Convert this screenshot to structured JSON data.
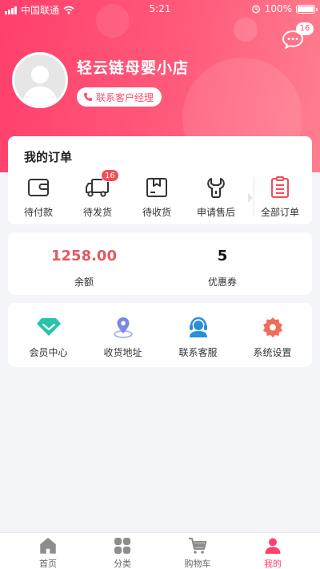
{
  "status_bar": {
    "carrier": "中国联通",
    "time": "5:21",
    "battery": "100%"
  },
  "header": {
    "message_badge": "16",
    "shop_name": "轻云链母婴小店",
    "contact_button": "联系客户经理"
  },
  "orders": {
    "title": "我的订单",
    "items": [
      {
        "label": "待付款",
        "icon": "wallet-icon"
      },
      {
        "label": "待发货",
        "icon": "truck-icon",
        "badge": "16"
      },
      {
        "label": "待收货",
        "icon": "box-icon"
      },
      {
        "label": "申请售后",
        "icon": "wrench-icon"
      },
      {
        "label": "全部订单",
        "icon": "list-icon"
      }
    ]
  },
  "stats": {
    "balance_value": "1258.00",
    "balance_label": "余额",
    "coupon_value": "5",
    "coupon_label": "优惠券"
  },
  "services": [
    {
      "label": "会员中心",
      "icon": "diamond-icon"
    },
    {
      "label": "收货地址",
      "icon": "location-pin-icon"
    },
    {
      "label": "联系客服",
      "icon": "headset-icon"
    },
    {
      "label": "系统设置",
      "icon": "gear-icon"
    }
  ],
  "tabbar": [
    {
      "label": "首页",
      "icon": "home-icon"
    },
    {
      "label": "分类",
      "icon": "grid-icon"
    },
    {
      "label": "购物车",
      "icon": "cart-icon"
    },
    {
      "label": "我的",
      "icon": "person-icon",
      "active": true
    }
  ],
  "colors": {
    "brand": "#ff4b6e",
    "balance": "#e05a63",
    "badge": "#f14d5b",
    "diamond": "#27c4a8",
    "location": "#7a86e8",
    "headset": "#2a8fd8",
    "gear": "#f06c5a"
  }
}
